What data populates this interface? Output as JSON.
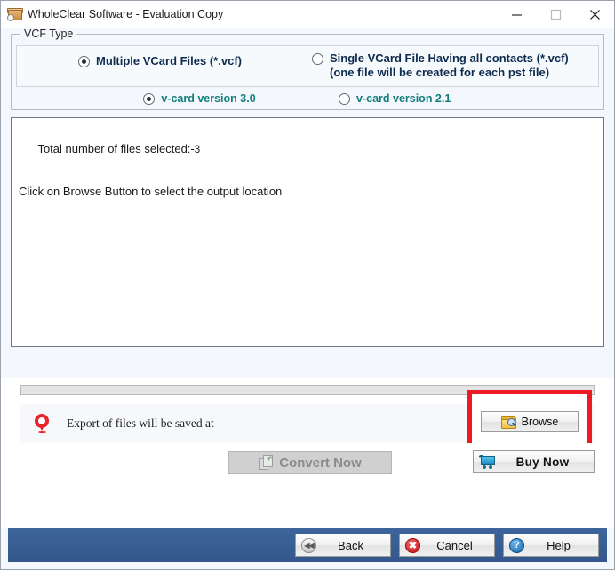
{
  "window": {
    "title": "WholeClear Software - Evaluation Copy",
    "app_icon": "archive-box-icon",
    "minimize_label": "—",
    "maximize_label": "□",
    "close_label": "✕"
  },
  "vcf_type": {
    "group_label": "VCF Type",
    "options": [
      {
        "label": "Multiple VCard Files (*.vcf)",
        "sublabel": "",
        "selected": true,
        "color": "#0d2b4e"
      },
      {
        "label": "Single VCard File Having all contacts (*.vcf)",
        "sublabel": "(one file will be created for each pst file)",
        "selected": false,
        "color": "#0d2b4e"
      }
    ],
    "versions": [
      {
        "label": "v-card version 3.0",
        "selected": true,
        "color": "#127d7d"
      },
      {
        "label": "v-card version 2.1",
        "selected": false,
        "color": "#127d7d"
      }
    ]
  },
  "log": {
    "line1_prefix": "Total number of files selected:-",
    "line1_count": "3",
    "line2": "Click on Browse Button to select the output location"
  },
  "output": {
    "progress_value": "0",
    "pin_icon": "location-pin-icon",
    "message": "Export of files will be saved at",
    "path_value": "",
    "browse_label": "Browse",
    "browse_icon": "folder-search-icon",
    "highlight_color": "#ea1b24"
  },
  "actions": {
    "convert_label": "Convert Now",
    "convert_icon": "convert-pages-icon",
    "convert_enabled": "false",
    "buy_label": "Buy Now",
    "buy_icon": "shopping-cart-icon"
  },
  "footer": {
    "bar_color": "#3a5f96",
    "buttons": [
      {
        "label": "Back",
        "icon": "rewind-icon",
        "glyph": "◀◀"
      },
      {
        "label": "Cancel",
        "icon": "cancel-x-icon",
        "glyph": "✖"
      },
      {
        "label": "Help",
        "icon": "help-question-icon",
        "glyph": "?"
      }
    ]
  }
}
